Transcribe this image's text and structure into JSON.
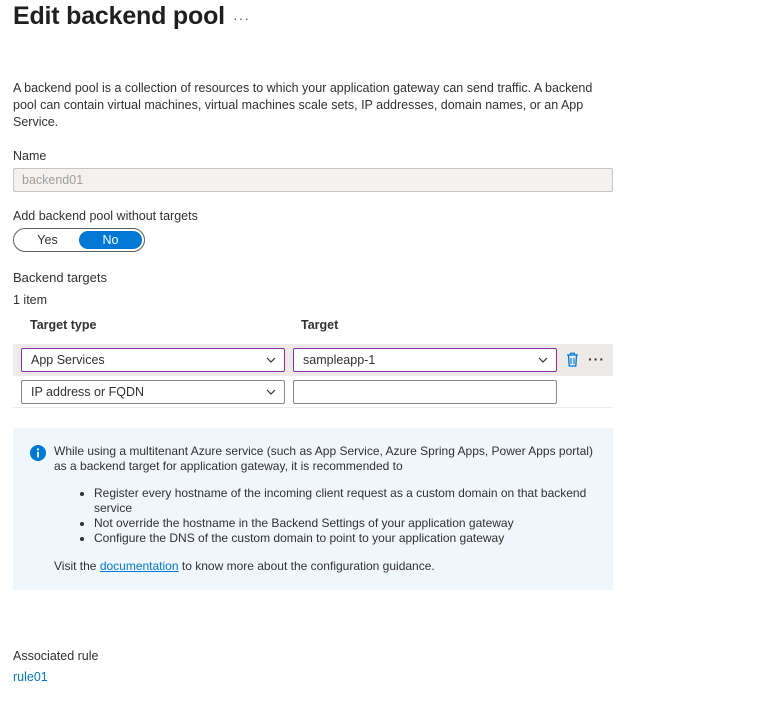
{
  "header": {
    "title": "Edit backend pool",
    "more_label": "···"
  },
  "description": "A backend pool is a collection of resources to which your application gateway can send traffic. A backend pool can contain virtual machines, virtual machines scale sets, IP addresses, domain names, or an App Service.",
  "name_field": {
    "label": "Name",
    "value": "backend01"
  },
  "without_targets": {
    "label": "Add backend pool without targets",
    "options": [
      "Yes",
      "No"
    ],
    "selected": "No"
  },
  "backend_targets": {
    "heading": "Backend targets",
    "count_text": "1 item",
    "columns": {
      "type": "Target type",
      "target": "Target"
    },
    "rows": [
      {
        "type": "App Services",
        "target": "sampleapp-1"
      },
      {
        "type": "IP address or FQDN",
        "target": ""
      }
    ],
    "row_more_label": "···"
  },
  "info_box": {
    "text": "While using a multitenant Azure service (such as App Service, Azure Spring Apps, Power Apps portal) as a backend target for application gateway, it is recommended to",
    "bullets": [
      "Register every hostname of the incoming client request as a custom domain on that backend service",
      "Not override the hostname in the Backend Settings of your application gateway",
      "Configure the DNS of the custom domain to point to your application gateway"
    ],
    "visit_prefix": "Visit the",
    "link_text": "documentation",
    "visit_suffix": "to know more about the configuration guidance."
  },
  "associated_rule": {
    "label": "Associated rule",
    "link": "rule01"
  },
  "colors": {
    "accent": "#0078d4",
    "focus_border": "#8a2da5",
    "info_background": "#eff6fc"
  }
}
